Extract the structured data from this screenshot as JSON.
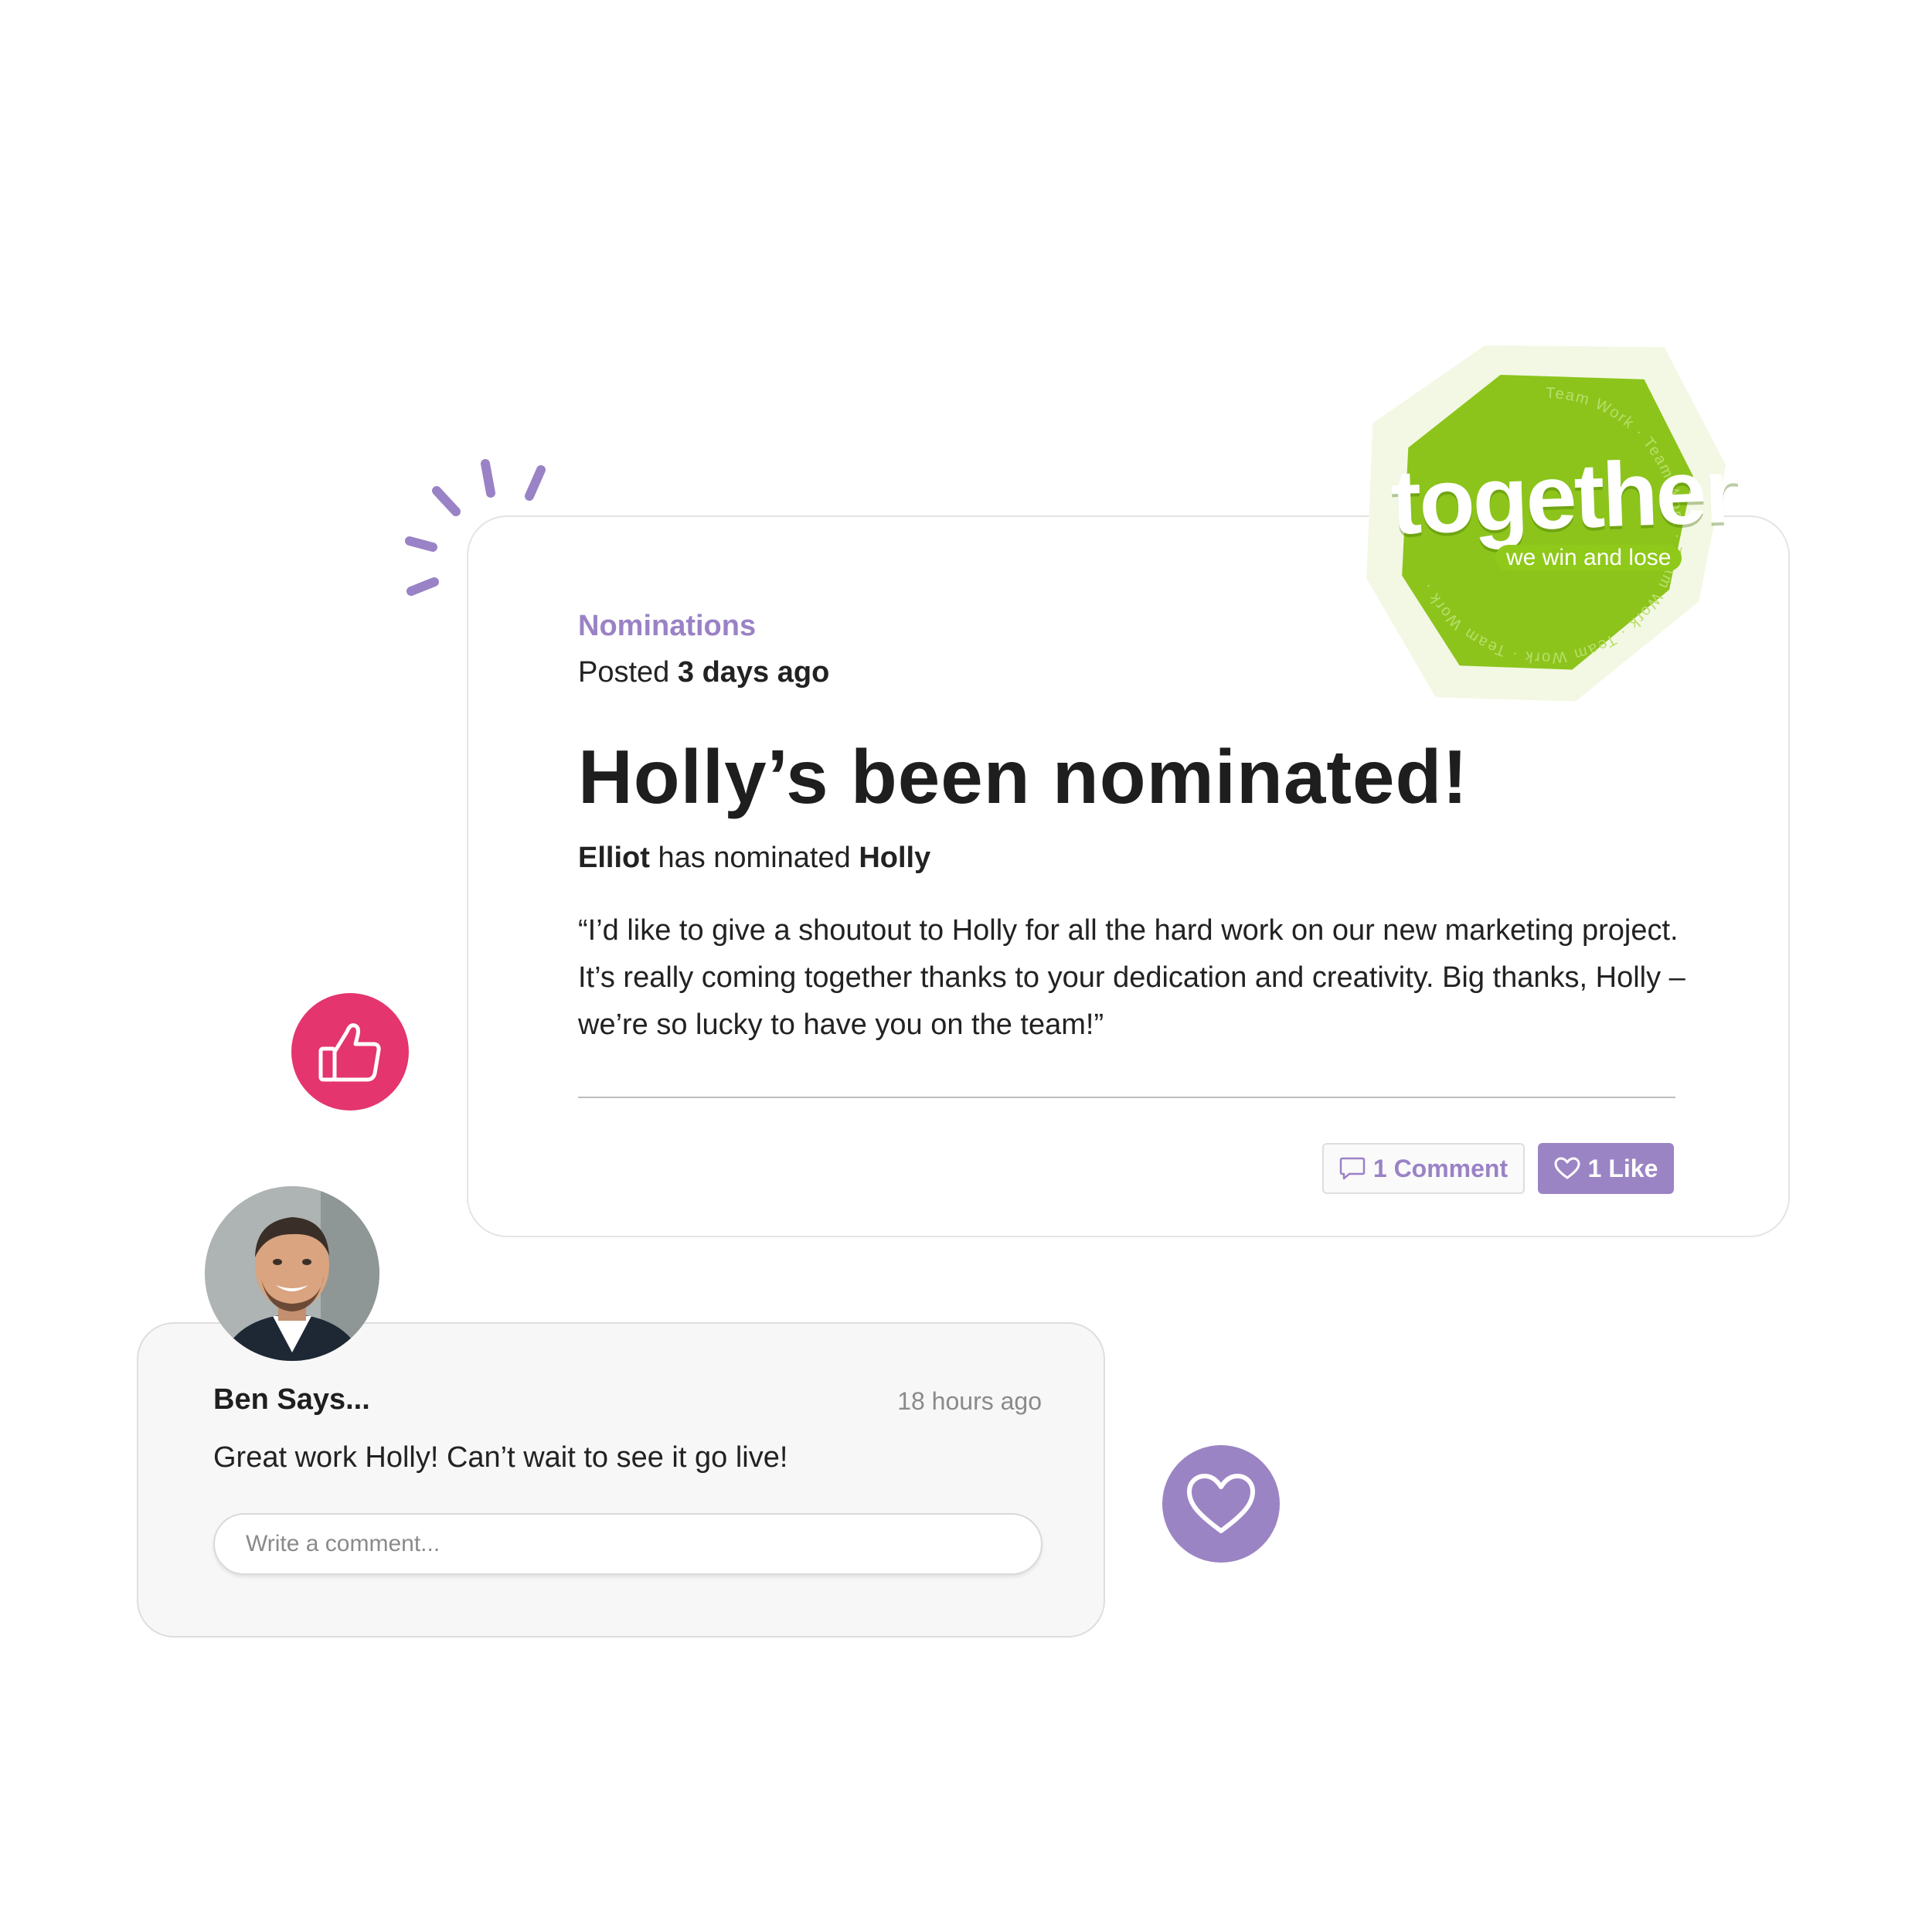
{
  "post": {
    "category": "Nominations",
    "posted_prefix": "Posted",
    "posted_time": "3 days ago",
    "title": "Holly’s been nominated!",
    "nominator": "Elliot",
    "nomination_verb": "has nominated",
    "nominee": "Holly",
    "quote": "“I’d like to give a shoutout to  Holly for all the hard work on our new marketing project. It’s really coming together thanks to your dedication and creativity. Big thanks, Holly – we’re so lucky to have you on the team!”",
    "comment_button_label": "1 Comment",
    "like_button_label": "1 Like"
  },
  "badge": {
    "word": "together",
    "subtitle": "we win and lose",
    "ring_text": "Team Work · Team Work · Team Work · Team Work ·",
    "colors": {
      "outer": "#f3f8e4",
      "inner": "#8cc41c"
    }
  },
  "comment": {
    "author": "Ben Says...",
    "time": "18 hours ago",
    "text": "Great work Holly! Can’t wait to see it go live!",
    "input_placeholder": "Write a comment..."
  },
  "icons": {
    "sparkle": "sparkle-lines-icon",
    "thumb": "thumbs-up-icon",
    "heart": "heart-icon",
    "comment": "comment-icon",
    "like": "heart-outline-icon"
  },
  "colors": {
    "accent_purple": "#9b84c4",
    "accent_pink": "#e4356e",
    "badge_green": "#8cc41c"
  }
}
